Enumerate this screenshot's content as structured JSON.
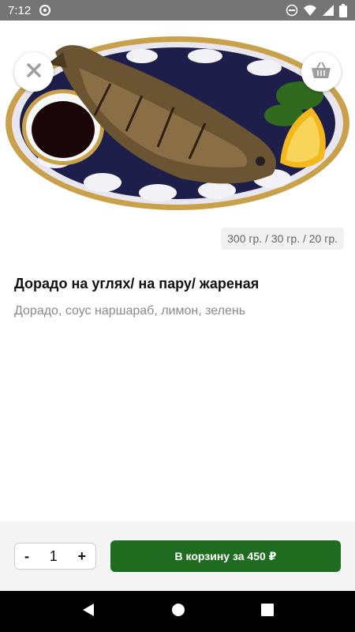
{
  "status_bar": {
    "time": "7:12",
    "icons": [
      "sync-icon",
      "do-not-disturb-icon",
      "wifi-icon",
      "signal-icon",
      "battery-icon"
    ]
  },
  "hero": {
    "image_description_icon": "grilled-fish-plate",
    "close_icon": "close-icon",
    "cart_icon": "basket-icon"
  },
  "dish": {
    "weight": "300 гр. / 30 гр. / 20 гр.",
    "title": "Дорадо на углях/ на пару/ жареная",
    "description": "Дорадо, соус наршараб, лимон, зелень"
  },
  "order": {
    "minus_label": "-",
    "quantity": "1",
    "plus_label": "+",
    "add_to_cart_label": "В корзину за 450 ₽"
  },
  "colors": {
    "status_bar": "#757575",
    "primary_button": "#1f6b1f",
    "nav_bar": "#000000"
  }
}
